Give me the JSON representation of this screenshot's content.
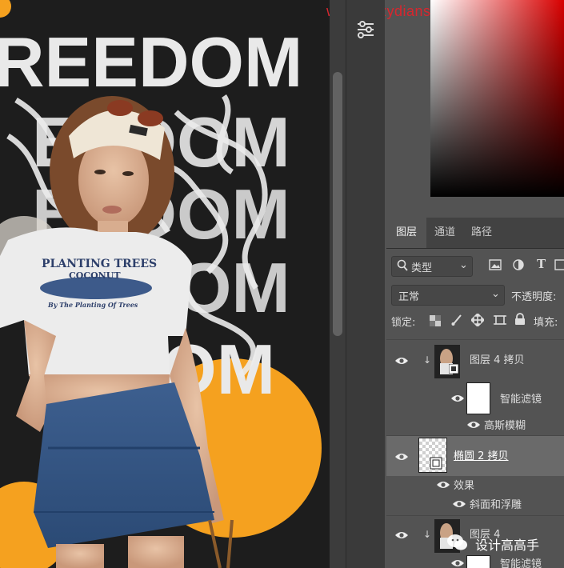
{
  "watermark_url": "www.hazydiansheji.com",
  "canvas": {
    "poster_words": [
      "REEDOM",
      "EEDOM",
      "EEDOM",
      "EEDOM",
      "EDOM"
    ],
    "shirt_lines": [
      "PLANTING TREES",
      "COCONUT",
      "By The Planting Of Trees"
    ]
  },
  "panel": {
    "tabs": [
      "图层",
      "通道",
      "路径"
    ],
    "active_tab": "图层",
    "filter_kind": "类型",
    "blend_mode": "正常",
    "opacity_label": "不透明度:",
    "lock_label": "锁定:",
    "fill_label": "填充:",
    "layers": [
      {
        "name": "图层 4 拷贝",
        "type": "smart-object"
      },
      {
        "name": "智能滤镜",
        "type": "smart-filters"
      },
      {
        "name": "高斯模糊",
        "type": "filter"
      },
      {
        "name": "椭圆 2 拷贝",
        "type": "shape",
        "selected": true
      },
      {
        "name": "效果",
        "type": "effects"
      },
      {
        "name": "斜面和浮雕",
        "type": "effect"
      },
      {
        "name": "图层 4",
        "type": "smart-object"
      },
      {
        "name": "智能滤镜",
        "type": "smart-filters"
      }
    ]
  },
  "bottom_watermark": "设计高高手",
  "colors": {
    "accent_orange": "#f5a11f",
    "panel_bg": "#535353",
    "selected_row": "#6a6a6a",
    "watermark_red": "#d8262e"
  }
}
